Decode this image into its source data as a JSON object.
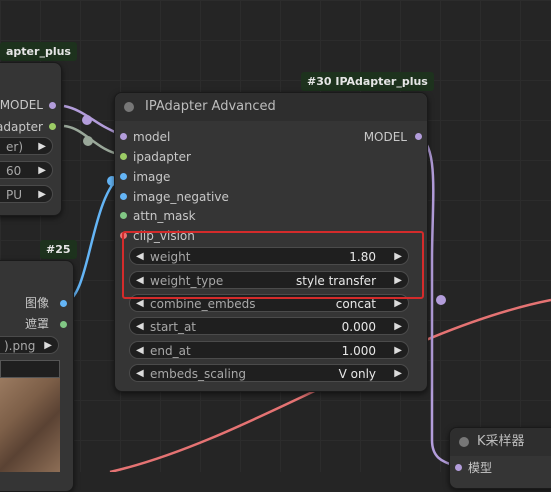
{
  "colors": {
    "model_link": "#b39ddb",
    "ipadapter_link": "#9aa89a",
    "image_link": "#64b5f6",
    "clip_link": "#e57373",
    "mask_dot": "#81c784",
    "badge_bg": "#1d321d",
    "highlight": "#d42b2b"
  },
  "left_node": {
    "badge": "apter_plus",
    "outputs": [
      "MODEL",
      "adapter"
    ],
    "widgets": [
      {
        "label": "er)"
      },
      {
        "label": "60"
      },
      {
        "label": "PU"
      }
    ]
  },
  "node25": {
    "badge": "#25",
    "outputs": [
      "图像",
      "遮罩"
    ],
    "widget": ").png"
  },
  "main_node": {
    "badge": "#30 IPAdapter_plus",
    "title": "IPAdapter Advanced",
    "title_icon": "circle-icon",
    "inputs": [
      "model",
      "ipadapter",
      "image",
      "image_negative",
      "attn_mask",
      "clip_vision"
    ],
    "output": "MODEL",
    "widgets": [
      {
        "label": "weight",
        "value": "1.80"
      },
      {
        "label": "weight_type",
        "value": "style transfer"
      },
      {
        "label": "combine_embeds",
        "value": "concat"
      },
      {
        "label": "start_at",
        "value": "0.000"
      },
      {
        "label": "end_at",
        "value": "1.000"
      },
      {
        "label": "embeds_scaling",
        "value": "V only"
      }
    ]
  },
  "ksampler": {
    "title": "K采样器",
    "input": "模型"
  },
  "icons": {
    "left": "◀",
    "right": "▶"
  }
}
